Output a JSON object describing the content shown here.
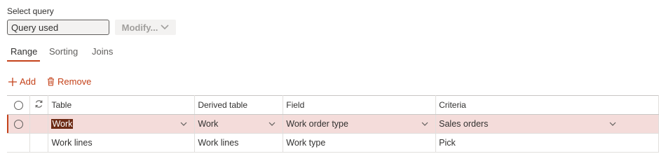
{
  "query": {
    "select_label": "Select query",
    "input_value": "Query used",
    "modify_label": "Modify..."
  },
  "tabs": [
    {
      "label": "Range",
      "active": true
    },
    {
      "label": "Sorting",
      "active": false
    },
    {
      "label": "Joins",
      "active": false
    }
  ],
  "toolbar": {
    "add_label": "Add",
    "remove_label": "Remove"
  },
  "grid": {
    "columns": [
      "Table",
      "Derived table",
      "Field",
      "Criteria"
    ],
    "rows": [
      {
        "table": "Work",
        "derived_table": "Work",
        "field": "Work order type",
        "criteria": "Sales orders",
        "selected": true
      },
      {
        "table": "Work lines",
        "derived_table": "Work lines",
        "field": "Work type",
        "criteria": "Pick",
        "selected": false
      }
    ]
  },
  "colors": {
    "accent": "#c4421a",
    "selected_row": "#f4dcda",
    "highlight_text_bg": "#6d2b15"
  },
  "icons": [
    "plus-icon",
    "trash-icon",
    "chevron-down-icon",
    "radio-circle-icon",
    "refresh-icon"
  ]
}
